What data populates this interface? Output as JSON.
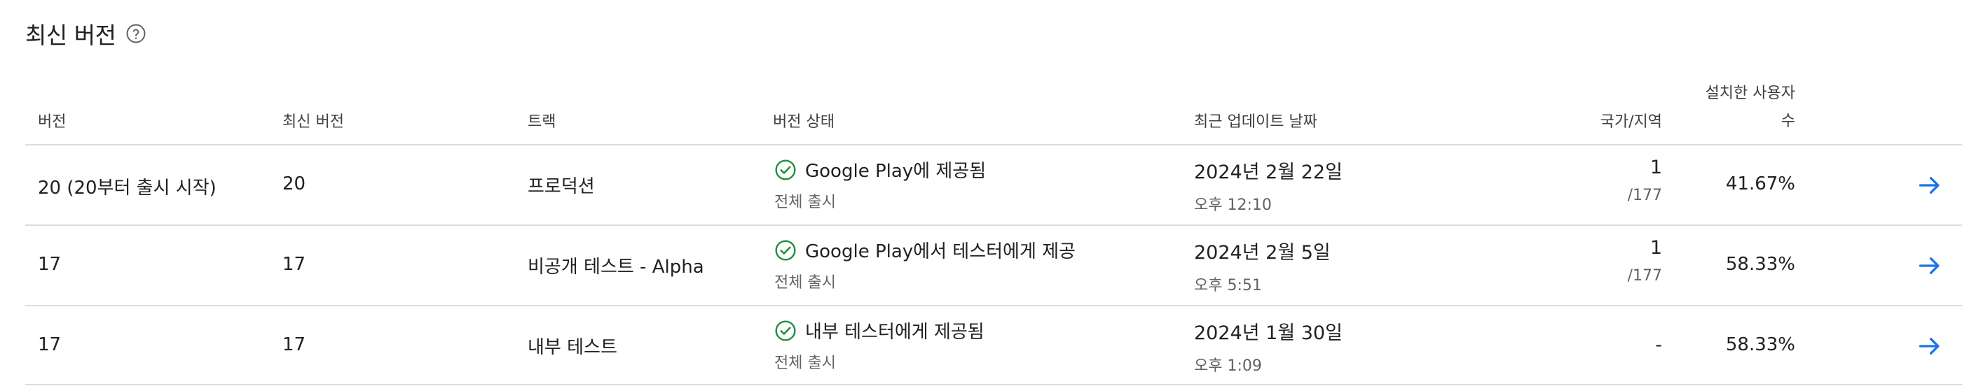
{
  "section": {
    "title": "최신 버전",
    "help_icon": "help-circle-icon"
  },
  "columns": {
    "version": "버전",
    "latest_version": "최신 버전",
    "track": "트랙",
    "release_status": "버전 상태",
    "last_updated": "최근 업데이트 날짜",
    "countries": "국가/지역",
    "installed_users_line1": "설치한 사용자",
    "installed_users_line2": "수"
  },
  "rows": [
    {
      "version": "20 (20부터 출시 시작)",
      "latest_version": "20",
      "track": "프로덕션",
      "status": "Google Play에 제공됨",
      "rollout": "전체 출시",
      "date": "2024년 2월 22일",
      "time": "오후 12:10",
      "countries": "1",
      "countries_total": "/177",
      "installed_pct": "41.67%"
    },
    {
      "version": "17",
      "latest_version": "17",
      "track": "비공개 테스트 - Alpha",
      "status": "Google Play에서 테스터에게 제공",
      "rollout": "전체 출시",
      "date": "2024년 2월 5일",
      "time": "오후 5:51",
      "countries": "1",
      "countries_total": "/177",
      "installed_pct": "58.33%"
    },
    {
      "version": "17",
      "latest_version": "17",
      "track": "내부 테스트",
      "status": "내부 테스터에게 제공됨",
      "rollout": "전체 출시",
      "date": "2024년 1월 30일",
      "time": "오후 1:09",
      "countries": "-",
      "countries_total": "",
      "installed_pct": "58.33%"
    }
  ],
  "colors": {
    "status_green": "#1e8e3e",
    "arrow_blue": "#1a73e8",
    "divider": "#dadce0"
  }
}
